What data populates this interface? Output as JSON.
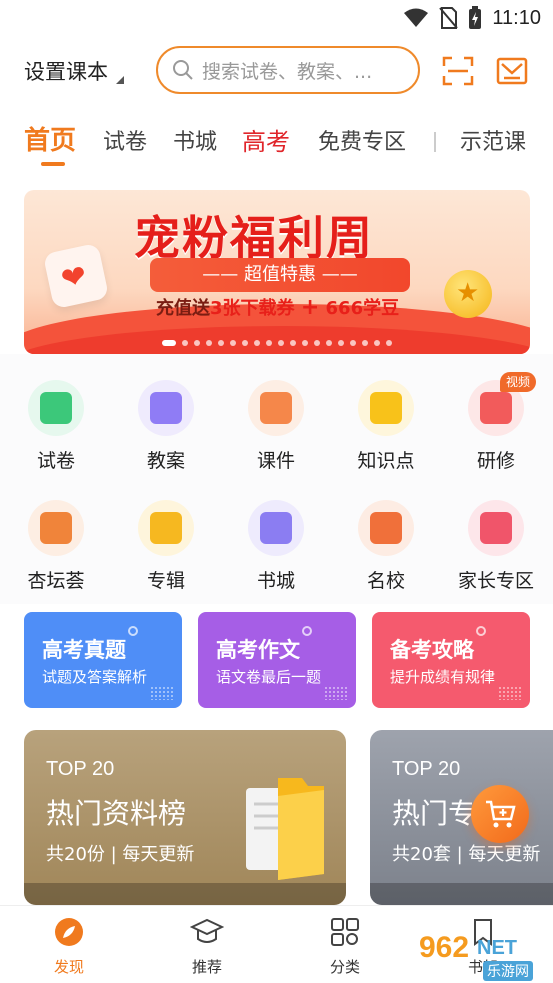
{
  "status_bar": {
    "time": "11:10"
  },
  "header": {
    "textbook_selector": "设置课本",
    "search_placeholder": "搜索试卷、教案、..."
  },
  "tabs": [
    {
      "label": "首页"
    },
    {
      "label": "试卷"
    },
    {
      "label": "书城"
    },
    {
      "label": "高考"
    },
    {
      "label": "免费专区"
    },
    {
      "label": "示范课"
    }
  ],
  "banner": {
    "title": "宠粉福利周",
    "tag": "—— 超值特惠 ——",
    "subtitle_prefix": "充值送",
    "subtitle_highlight1": "3张下载券",
    "subtitle_plus": "+",
    "subtitle_highlight2": "666学豆"
  },
  "categories_row1": [
    {
      "label": "试卷",
      "icon": "exam-icon",
      "color": "#3cc87a"
    },
    {
      "label": "教案",
      "icon": "lesson-plan-icon",
      "color": "#8f7cf5"
    },
    {
      "label": "课件",
      "icon": "courseware-icon",
      "color": "#f5874a"
    },
    {
      "label": "知识点",
      "icon": "knowledge-icon",
      "color": "#f8c21a"
    },
    {
      "label": "研修",
      "icon": "training-video-icon",
      "color": "#f25b5b"
    }
  ],
  "categories_row2": [
    {
      "label": "杏坛荟",
      "icon": "forum-icon",
      "color": "#f0843a"
    },
    {
      "label": "专辑",
      "icon": "album-folder-icon",
      "color": "#f6b820"
    },
    {
      "label": "书城",
      "icon": "bookstore-icon",
      "color": "#8b7df2"
    },
    {
      "label": "名校",
      "icon": "school-cap-icon",
      "color": "#f0703a"
    },
    {
      "label": "家长专区",
      "icon": "parent-star-icon",
      "color": "#f0556a"
    }
  ],
  "video_badge": "视频",
  "feature_cards": [
    {
      "title": "高考真题",
      "subtitle": "试题及答案解析",
      "color": "#4f8ef7"
    },
    {
      "title": "高考作文",
      "subtitle": "语文卷最后一题",
      "color": "#a65ee6"
    },
    {
      "title": "备考攻略",
      "subtitle": "提升成绩有规律",
      "color": "#f55a6e"
    }
  ],
  "rank_cards": [
    {
      "top": "TOP 20",
      "name": "热门资料榜",
      "meta": "共20份 | 每天更新",
      "color": "#b59a6e"
    },
    {
      "top": "TOP 20",
      "name": "热门专",
      "meta": "共20套 | 每天更新",
      "color": "#8a8f99"
    }
  ],
  "bottom_nav": [
    {
      "label": "发现",
      "icon": "discover-icon"
    },
    {
      "label": "推荐",
      "icon": "recommend-cap-icon"
    },
    {
      "label": "分类",
      "icon": "category-grid-icon"
    },
    {
      "label": "书架",
      "icon": "bookshelf-icon"
    }
  ],
  "watermark": {
    "brand": "962",
    "suffix": "NET",
    "caption": "乐游网"
  },
  "colors": {
    "accent": "#f07a1e",
    "hot": "#e0252a"
  }
}
